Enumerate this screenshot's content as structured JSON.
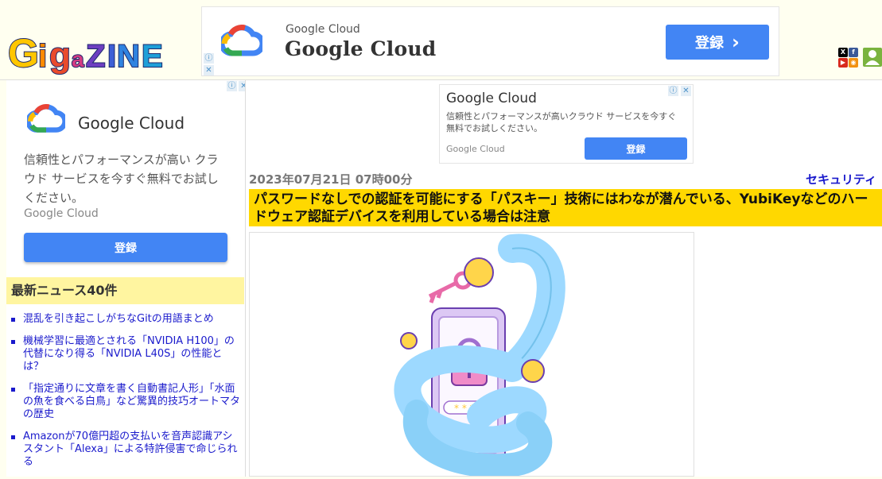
{
  "site": {
    "logo_text": "GIGAZINE"
  },
  "top_ad": {
    "small_label": "Google Cloud",
    "big_label": "Google Cloud",
    "cta_label": "登録",
    "cta_chevron": "›"
  },
  "ad_choice": {
    "info_glyph": "ⓘ",
    "close_glyph": "✕"
  },
  "social": {
    "icons": [
      "x-icon",
      "facebook-icon",
      "youtube-icon",
      "rss-icon",
      "user-icon"
    ]
  },
  "sidebar_ad": {
    "name": "Google Cloud",
    "description": "信頼性とパフォーマンスが高い クラウド サービスを今すぐ無料でお試しください。",
    "brand": "Google Cloud",
    "button_label": "登録"
  },
  "news": {
    "header": "最新ニュース40件",
    "items": [
      "混乱を引き起こしがちなGitの用語まとめ",
      "機械学習に最適とされる「NVIDIA H100」の代替になり得る「NVIDIA L40S」の性能とは？",
      "「指定通りに文章を書く自動書記人形」「水面の魚を食べる白鳥」など驚異的技巧オートマタの歴史",
      "Amazonが70億円超の支払いを音声認識アシスタント「Alexa」による特許侵害で命じられる"
    ]
  },
  "main_ad": {
    "title": "Google Cloud",
    "description": "信頼性とパフォーマンスが高いクラウド サービスを今すぐ無料でお試しください。",
    "brand": "Google Cloud",
    "button_label": "登録"
  },
  "article": {
    "date": "2023年07月21日 07時00分",
    "category": "セキュリティ",
    "headline": "パスワードなしでの認証を可能にする「パスキー」技術にはわなが潜んでいる、YubiKeyなどのハードウェア認証デバイスを利用している場合は注意",
    "password_mask": "* * *"
  },
  "colors": {
    "accent_blue": "#4285f4",
    "headline_bg": "#ffd800",
    "news_header_bg": "#fff5a0",
    "link": "#1a1acc"
  }
}
